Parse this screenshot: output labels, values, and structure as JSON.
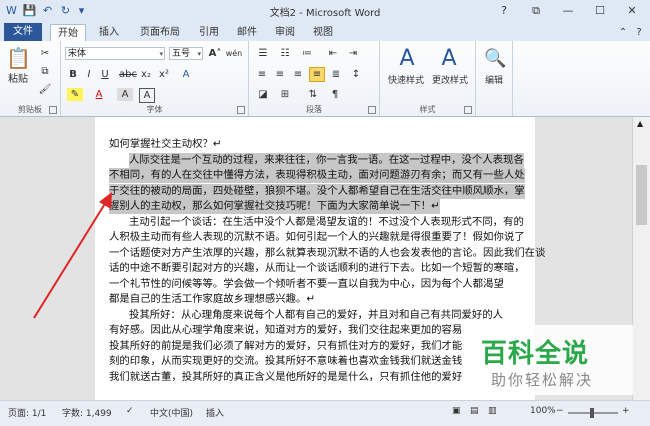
{
  "window": {
    "title": "文档2 - Microsoft Word",
    "qat": {
      "save": "💾",
      "undo": "↶",
      "redo": "↻",
      "customize": "▾"
    },
    "controls": {
      "help": "?",
      "ribbon_opts": "⧉",
      "minimize": "—",
      "maximize": "☐",
      "close": "✕"
    }
  },
  "ribbon": {
    "file_tab": "文件",
    "tabs": [
      "开始",
      "插入",
      "页面布局",
      "引用",
      "邮件",
      "审阅",
      "视图"
    ],
    "active_tab": "开始",
    "right_icons": {
      "help": "?",
      "collapse": "⌃"
    },
    "clipboard": {
      "label": "剪贴板",
      "paste": "粘贴"
    },
    "font": {
      "label": "字体",
      "name": "宋体",
      "size": "五号",
      "wen": "wén",
      "a_char": "A"
    },
    "paragraph": {
      "label": "段落"
    },
    "styles": {
      "label": "样式",
      "quick": "快速样式",
      "change": "更改样式"
    },
    "editing": {
      "label": "编辑"
    }
  },
  "document": {
    "lines": [
      {
        "text": "如何掌握社交主动权？↵",
        "indent": false,
        "selected": false
      },
      {
        "text": "人际交往是一个互动的过程，来来往往，你一言我一语。在这一过程中，没个人表现各",
        "indent": true,
        "selected": true
      },
      {
        "text": "不相同，有的人在交往中懂得方法，表现得积极主动，面对问题游刃有余；而又有一些人处",
        "indent": false,
        "selected": true
      },
      {
        "text": "于交往的被动的局面，四处碰壁，狼狈不堪。没个人都希望自己在生活交往中顺风顺水，掌",
        "indent": false,
        "selected": true
      },
      {
        "text": "握别人的主动权，那么如何掌握社交技巧呢！下面为大家简单说一下！↵",
        "indent": false,
        "selected": true
      },
      {
        "text": "主动引起一个谈话：在生活中没个人都是渴望友谊的！不过没个人表现形式不同，有的",
        "indent": true,
        "selected": false
      },
      {
        "text": "人积极主动而有些人表现的沉默不语。如何引起一个人的兴趣就是得很重要了！假如你说了",
        "indent": false,
        "selected": false
      },
      {
        "text": "一个话题使对方产生浓厚的兴趣，那么就算表现沉默不语的人也会发表他的言论。因此我们在谈",
        "indent": false,
        "selected": false
      },
      {
        "text": "话的中途不断要引起对方的兴趣，从而让一个谈话顺利的进行下去。比如一个短暂的寒暄，",
        "indent": false,
        "selected": false
      },
      {
        "text": "一个礼节性的问候等等。学会做一个倾听者不要一直以自我为中心，因为每个人都渴望",
        "indent": false,
        "selected": false
      },
      {
        "text": "都是自己的生活工作家庭故乡理想感兴趣。↵",
        "indent": false,
        "selected": false
      },
      {
        "text": "投其所好：从心理角度来说每个人都有自己的爱好，并且对和自己有共同爱好的人",
        "indent": true,
        "selected": false
      },
      {
        "text": "有好感。因此从心理学角度来说，知道对方的爱好，我们交往起来更加的容易",
        "indent": false,
        "selected": false
      },
      {
        "text": "投其所好的前提是我们必须了解对方的爱好，只有抓住对方的爱好，我们才能",
        "indent": false,
        "selected": false
      },
      {
        "text": "刻的印象，从而实现更好的交流。投其所好不意味着也喜欢金钱我们就送金钱",
        "indent": false,
        "selected": false
      },
      {
        "text": "我们就送古董，投其所好的真正含义是他所好的是是什么，只有抓住他的爱好",
        "indent": false,
        "selected": false
      }
    ]
  },
  "status": {
    "page": "页面: 1/1",
    "words": "字数: 1,499",
    "lang": "中文(中国)",
    "mode": "插入",
    "zoom": "100%"
  },
  "watermark": {
    "title": "百科全说",
    "subtitle": "助你轻松解决"
  },
  "colors": {
    "accent": "#2b579a",
    "selection": "#c7c7c7",
    "arrow": "#e02424",
    "watermark": "#2aa84a"
  }
}
